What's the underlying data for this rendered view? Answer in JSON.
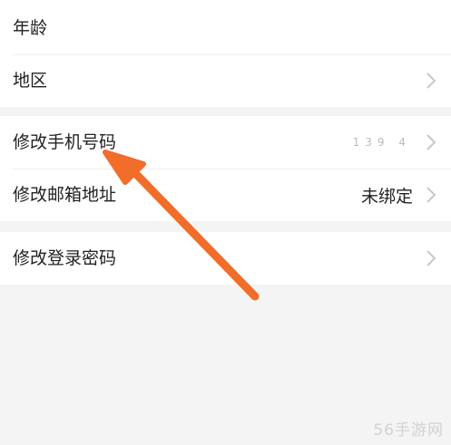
{
  "settings": {
    "group1": [
      {
        "label": "年龄"
      },
      {
        "label": "地区"
      }
    ],
    "group2": [
      {
        "label": "修改手机号码",
        "value": "139 4"
      },
      {
        "label": "修改邮箱地址",
        "value": "未绑定"
      }
    ],
    "group3": [
      {
        "label": "修改登录密码"
      }
    ]
  },
  "watermark": "56手游网",
  "colors": {
    "arrow": "#f26c2a",
    "background": "#f4f4f4",
    "row": "#ffffff",
    "chevron": "#c8c8c8"
  },
  "icons": [
    "chevron-right-icon",
    "annotation-arrow-icon"
  ]
}
